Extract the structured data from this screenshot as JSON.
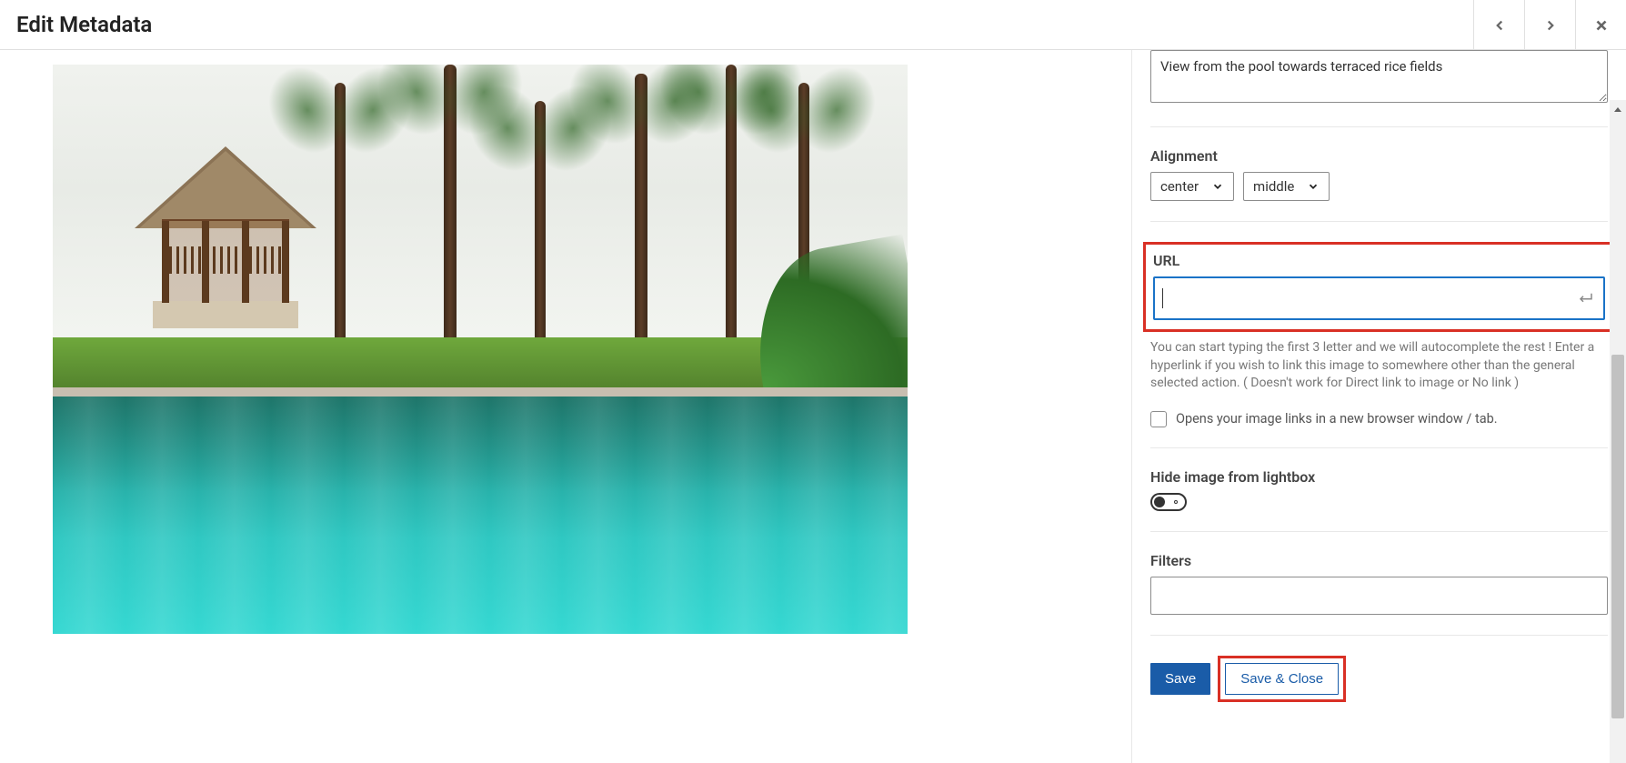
{
  "header": {
    "title": "Edit Metadata"
  },
  "caption": {
    "value": "View from the pool towards terraced rice fields"
  },
  "alignment": {
    "label": "Alignment",
    "horizontal": "center",
    "vertical": "middle"
  },
  "url": {
    "label": "URL",
    "value": "",
    "help_text": "You can start typing the first 3 letter and we will autocomplete the rest ! Enter a hyperlink if you wish to link this image to somewhere other than the general selected action. ( Doesn't work for Direct link to image or No link )",
    "new_window_label": "Opens your image links in a new browser window / tab."
  },
  "lightbox": {
    "label": "Hide image from lightbox"
  },
  "filters": {
    "label": "Filters",
    "value": ""
  },
  "buttons": {
    "save": "Save",
    "save_close": "Save & Close"
  }
}
